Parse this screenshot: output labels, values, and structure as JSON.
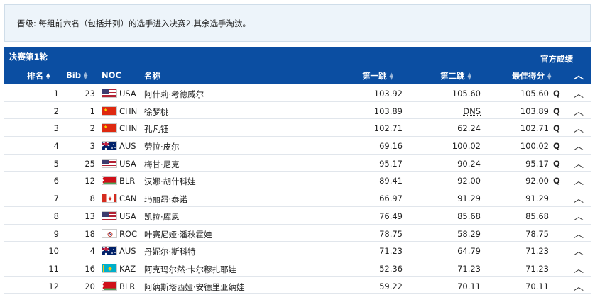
{
  "note": "晋级: 每组前六名（包括并列）的选手进入决赛2.其余选手淘汰。",
  "section_title": "决赛第1轮",
  "official_label": "官方成绩",
  "headers": {
    "rank": "排名",
    "bib": "Bib",
    "noc": "NOC",
    "name": "名称",
    "jump1": "第一跳",
    "jump2": "第二跳",
    "best": "最佳得分"
  },
  "rows": [
    {
      "rank": "1",
      "bib": "23",
      "noc": "USA",
      "name": "阿什莉·考德威尔",
      "j1": "103.92",
      "j2": "105.60",
      "best": "105.60",
      "q": "Q"
    },
    {
      "rank": "2",
      "bib": "1",
      "noc": "CHN",
      "name": "徐梦桃",
      "j1": "103.89",
      "j2": "DNS",
      "best": "103.89",
      "q": "Q"
    },
    {
      "rank": "3",
      "bib": "2",
      "noc": "CHN",
      "name": "孔凡钰",
      "j1": "102.71",
      "j2": "62.24",
      "best": "102.71",
      "q": "Q"
    },
    {
      "rank": "4",
      "bib": "3",
      "noc": "AUS",
      "name": "劳拉·皮尔",
      "j1": "69.16",
      "j2": "100.02",
      "best": "100.02",
      "q": "Q"
    },
    {
      "rank": "5",
      "bib": "25",
      "noc": "USA",
      "name": "梅甘·尼克",
      "j1": "95.17",
      "j2": "90.24",
      "best": "95.17",
      "q": "Q"
    },
    {
      "rank": "6",
      "bib": "12",
      "noc": "BLR",
      "name": "汉娜·胡什科娃",
      "j1": "89.41",
      "j2": "92.00",
      "best": "92.00",
      "q": "Q"
    },
    {
      "rank": "7",
      "bib": "8",
      "noc": "CAN",
      "name": "玛丽昂·泰诺",
      "j1": "66.97",
      "j2": "91.29",
      "best": "91.29",
      "q": ""
    },
    {
      "rank": "8",
      "bib": "13",
      "noc": "USA",
      "name": "凯拉·库恩",
      "j1": "76.49",
      "j2": "85.68",
      "best": "85.68",
      "q": ""
    },
    {
      "rank": "9",
      "bib": "18",
      "noc": "ROC",
      "name": "叶赛尼娅·潘秋霍娃",
      "j1": "78.75",
      "j2": "58.29",
      "best": "78.75",
      "q": ""
    },
    {
      "rank": "10",
      "bib": "4",
      "noc": "AUS",
      "name": "丹妮尔·斯科特",
      "j1": "71.23",
      "j2": "64.79",
      "best": "71.23",
      "q": ""
    },
    {
      "rank": "11",
      "bib": "16",
      "noc": "KAZ",
      "name": "阿克玛尔然·卡尔穆扎耶娃",
      "j1": "52.36",
      "j2": "71.23",
      "best": "71.23",
      "q": ""
    },
    {
      "rank": "12",
      "bib": "20",
      "noc": "BLR",
      "name": "阿纳斯塔西娅·安德里亚纳娃",
      "j1": "59.22",
      "j2": "70.11",
      "best": "70.11",
      "q": ""
    }
  ],
  "colors": {
    "header_blue": "#0b4ea2",
    "note_bg": "#edf4fa"
  }
}
